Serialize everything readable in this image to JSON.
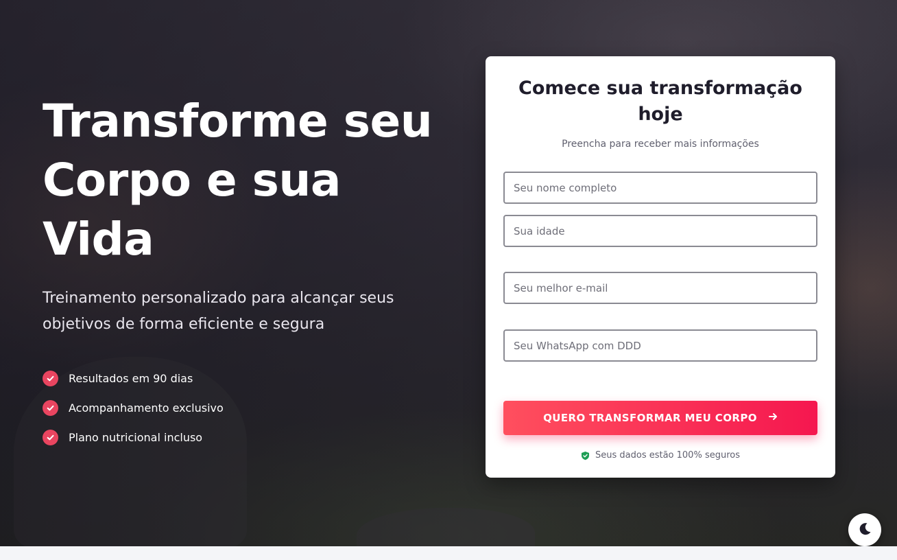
{
  "hero": {
    "title": "Transforme seu\nCorpo e sua\nVida",
    "subtitle": "Treinamento personalizado para alcançar seus objetivos de forma eficiente e segura",
    "features": [
      "Resultados em 90 dias",
      "Acompanhamento exclusivo",
      "Plano nutricional incluso"
    ]
  },
  "form": {
    "title": "Comece sua transformação hoje",
    "subtitle": "Preencha para receber mais informações",
    "fields": {
      "name_placeholder": "Seu nome completo",
      "age_placeholder": "Sua idade",
      "email_placeholder": "Seu melhor e-mail",
      "whatsapp_placeholder": "Seu WhatsApp com DDD"
    },
    "submit_label": "QUERO TRANSFORMAR MEU CORPO",
    "secure_note": "Seus dados estão 100% seguros"
  },
  "icons": {
    "check": "check-circle-icon",
    "arrow": "arrow-right-icon",
    "shield": "shield-icon",
    "theme": "moon-icon"
  },
  "colors": {
    "accent": "#f5174f",
    "check_bg": "#e94560",
    "secure_green": "#1e9e55"
  }
}
